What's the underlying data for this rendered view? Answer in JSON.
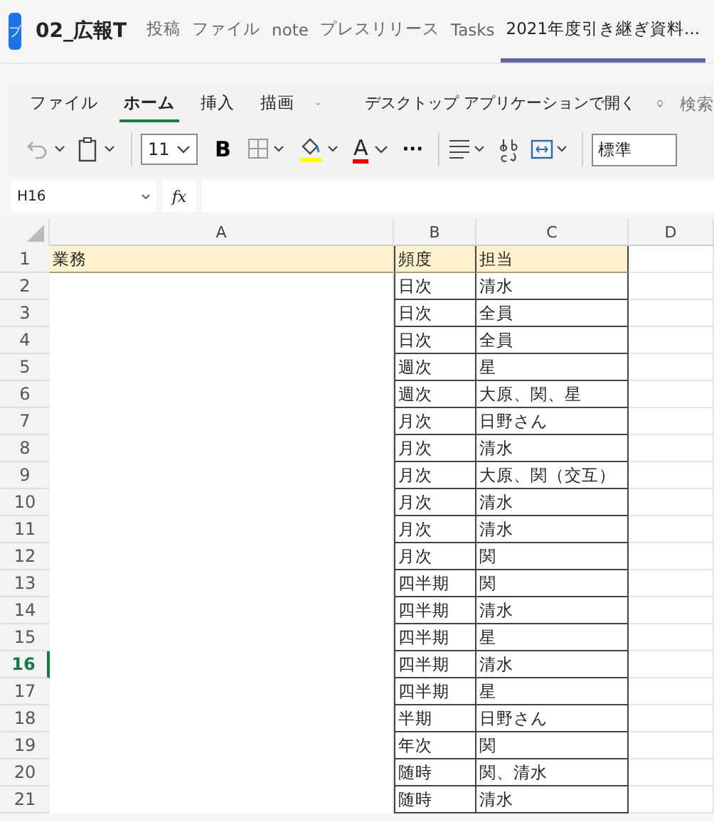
{
  "team": {
    "avatar": "ブ",
    "name": "02_広報T"
  },
  "channel_tabs": [
    {
      "label": "投稿",
      "selected": false
    },
    {
      "label": "ファイル",
      "selected": false
    },
    {
      "label": "note",
      "selected": false
    },
    {
      "label": "プレスリリース",
      "selected": false
    },
    {
      "label": "Tasks",
      "selected": false
    },
    {
      "label": "2021年度引き継ぎ資料...",
      "selected": true
    }
  ],
  "ribbon_tabs": [
    {
      "label": "ファイル",
      "selected": false
    },
    {
      "label": "ホーム",
      "selected": true
    },
    {
      "label": "挿入",
      "selected": false
    },
    {
      "label": "描画",
      "selected": false
    }
  ],
  "open_desktop": "デスクトップ アプリケーションで開く",
  "search": "検索",
  "toolbar": {
    "font_size": "11",
    "bold": "B",
    "font_color": "A",
    "more": "···",
    "number_format": "標準"
  },
  "formula_bar": {
    "cell": "H16",
    "fx": "fx"
  },
  "columns": [
    {
      "label": "A"
    },
    {
      "label": "B"
    },
    {
      "label": "C"
    },
    {
      "label": "D"
    }
  ],
  "rows": [
    {
      "n": "1",
      "kind": "header",
      "selected": false,
      "a": "業務",
      "b": "頻度",
      "c": "担当"
    },
    {
      "n": "2",
      "kind": "data",
      "selected": false,
      "b": "日次",
      "c": "清水"
    },
    {
      "n": "3",
      "kind": "data",
      "selected": false,
      "b": "日次",
      "c": "全員"
    },
    {
      "n": "4",
      "kind": "data",
      "selected": false,
      "b": "日次",
      "c": "全員"
    },
    {
      "n": "5",
      "kind": "data",
      "selected": false,
      "b": "週次",
      "c": "星"
    },
    {
      "n": "6",
      "kind": "data",
      "selected": false,
      "b": "週次",
      "c": "大原、関、星"
    },
    {
      "n": "7",
      "kind": "data",
      "selected": false,
      "b": "月次",
      "c": "日野さん"
    },
    {
      "n": "8",
      "kind": "data",
      "selected": false,
      "b": "月次",
      "c": "清水"
    },
    {
      "n": "9",
      "kind": "data",
      "selected": false,
      "b": "月次",
      "c": "大原、関（交互）"
    },
    {
      "n": "10",
      "kind": "data",
      "selected": false,
      "b": "月次",
      "c": "清水"
    },
    {
      "n": "11",
      "kind": "data",
      "selected": false,
      "b": "月次",
      "c": "清水"
    },
    {
      "n": "12",
      "kind": "data",
      "selected": false,
      "b": "月次",
      "c": "関"
    },
    {
      "n": "13",
      "kind": "data",
      "selected": false,
      "b": "四半期",
      "c": "関"
    },
    {
      "n": "14",
      "kind": "data",
      "selected": false,
      "b": "四半期",
      "c": "清水"
    },
    {
      "n": "15",
      "kind": "data",
      "selected": false,
      "b": "四半期",
      "c": "星"
    },
    {
      "n": "16",
      "kind": "data",
      "selected": true,
      "b": "四半期",
      "c": "清水"
    },
    {
      "n": "17",
      "kind": "data",
      "selected": false,
      "b": "四半期",
      "c": "星"
    },
    {
      "n": "18",
      "kind": "data",
      "selected": false,
      "b": "半期",
      "c": "日野さん"
    },
    {
      "n": "19",
      "kind": "data",
      "selected": false,
      "b": "年次",
      "c": "関"
    },
    {
      "n": "20",
      "kind": "data",
      "selected": false,
      "b": "随時",
      "c": "関、清水"
    },
    {
      "n": "21",
      "kind": "data",
      "selected": false,
      "b": "随時",
      "c": "清水"
    }
  ]
}
